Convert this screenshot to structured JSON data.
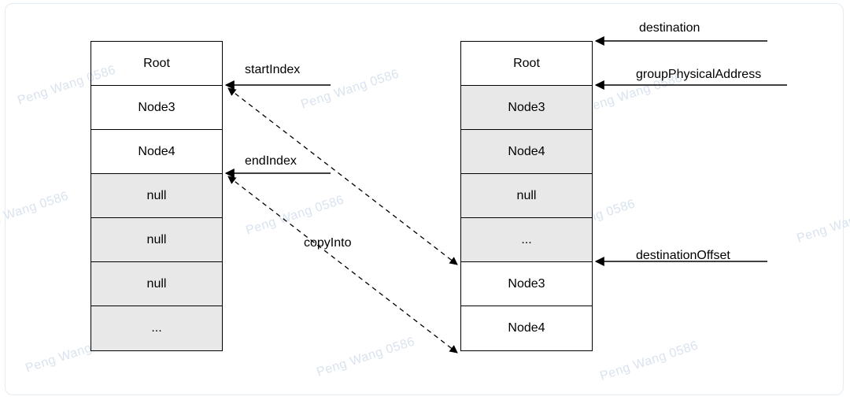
{
  "watermark_text": "Peng Wang 0586",
  "left_stack": {
    "cells": [
      {
        "text": "Root",
        "shaded": false
      },
      {
        "text": "Node3",
        "shaded": false
      },
      {
        "text": "Node4",
        "shaded": false
      },
      {
        "text": "null",
        "shaded": true
      },
      {
        "text": "null",
        "shaded": true
      },
      {
        "text": "null",
        "shaded": true
      },
      {
        "text": "...",
        "shaded": true
      }
    ]
  },
  "right_stack": {
    "cells": [
      {
        "text": "Root",
        "shaded": false
      },
      {
        "text": "Node3",
        "shaded": true
      },
      {
        "text": "Node4",
        "shaded": true
      },
      {
        "text": "null",
        "shaded": true
      },
      {
        "text": "...",
        "shaded": true
      },
      {
        "text": "Node3",
        "shaded": false
      },
      {
        "text": "Node4",
        "shaded": false
      }
    ]
  },
  "labels": {
    "startIndex": "startIndex",
    "endIndex": "endIndex",
    "copyInto": "copyInto",
    "destination": "destination",
    "groupPhysicalAddress": "groupPhysicalAddress",
    "destinationOffset": "destinationOffset"
  },
  "chart_data": {
    "type": "diagram",
    "description": "Two array/stack visualizations showing a copyInto memory operation. Left stack is source starting at startIndex through endIndex (Node3, Node4) copied into the destination (right stack) at destinationOffset. Right stack's shaded region (Node3, Node4, null, ...) begins at groupPhysicalAddress.",
    "source_stack": [
      "Root",
      "Node3",
      "Node4",
      "null",
      "null",
      "null",
      "..."
    ],
    "source_startIndex_row": 1,
    "source_endIndex_row": 3,
    "destination_stack": [
      "Root",
      "Node3",
      "Node4",
      "null",
      "...",
      "Node3",
      "Node4"
    ],
    "destination_pointer_row": 0,
    "groupPhysicalAddress_row": 1,
    "destinationOffset_row": 5,
    "operation_label": "copyInto"
  }
}
